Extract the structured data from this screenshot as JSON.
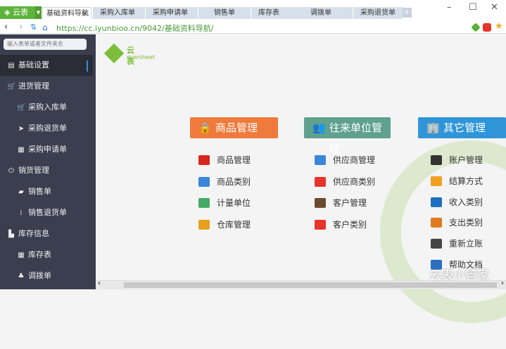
{
  "browser": {
    "brand": "云表",
    "tabs": [
      "基础资料导航",
      "采购入库单",
      "采购申请单",
      "销售单",
      "库存表",
      "调拨单",
      "采购退货单"
    ],
    "url": "https://cc.iyunbioo.cn/9042/基础资料导航/",
    "window": {
      "minimize": "–",
      "maximize": "☐",
      "close": "✕"
    }
  },
  "sidebar": {
    "search_placeholder": "输入表单或者文件夹名",
    "items": [
      {
        "label": "基础设置",
        "icon": "file-icon",
        "glyph": "▤"
      },
      {
        "label": "进货管理",
        "icon": "cart-icon",
        "glyph": "🛒"
      },
      {
        "label": "采购入库单",
        "icon": "cart-icon",
        "glyph": "🛒"
      },
      {
        "label": "采购退货单",
        "icon": "send-icon",
        "glyph": "➤"
      },
      {
        "label": "采购申请单",
        "icon": "clipboard-icon",
        "glyph": "▦"
      },
      {
        "label": "销货管理",
        "icon": "power-icon",
        "glyph": "⏻"
      },
      {
        "label": "销售单",
        "icon": "wallet-icon",
        "glyph": "▰"
      },
      {
        "label": "销售退货单",
        "icon": "bars-icon",
        "glyph": "⁞"
      },
      {
        "label": "库存信息",
        "icon": "building-icon",
        "glyph": "▙"
      },
      {
        "label": "库存表",
        "icon": "grid-icon",
        "glyph": "▦"
      },
      {
        "label": "调拨单",
        "icon": "sitemap-icon",
        "glyph": "♣"
      }
    ]
  },
  "logo": {
    "cn": "云表",
    "en": "eversheet"
  },
  "sections": [
    {
      "title": "商品管理",
      "color": "#f07a3c",
      "glyph": "🔒",
      "items": [
        {
          "label": "商品管理",
          "color": "#d9261c"
        },
        {
          "label": "商品类别",
          "color": "#3a86d8"
        },
        {
          "label": "计量单位",
          "color": "#4a6"
        },
        {
          "label": "仓库管理",
          "color": "#e8a020"
        }
      ]
    },
    {
      "title": "往来单位管理",
      "color": "#5fa08f",
      "glyph": "👥",
      "items": [
        {
          "label": "供应商管理",
          "color": "#3a86d8"
        },
        {
          "label": "供应商类别",
          "color": "#e8322a"
        },
        {
          "label": "客户管理",
          "color": "#6b4a30"
        },
        {
          "label": "客户类别",
          "color": "#e8322a"
        }
      ]
    },
    {
      "title": "其它管理",
      "color": "#2f95d8",
      "glyph": "🏢",
      "items": [
        {
          "label": "账户管理",
          "color": "#333"
        },
        {
          "label": "结算方式",
          "color": "#f0a020"
        },
        {
          "label": "收入类别",
          "color": "#1f6fc0"
        },
        {
          "label": "支出类别",
          "color": "#e07a20"
        },
        {
          "label": "重新立账",
          "color": "#444"
        },
        {
          "label": "帮助文档",
          "color": "#2a6fc0"
        }
      ]
    }
  ],
  "watermark": "云表小管家"
}
